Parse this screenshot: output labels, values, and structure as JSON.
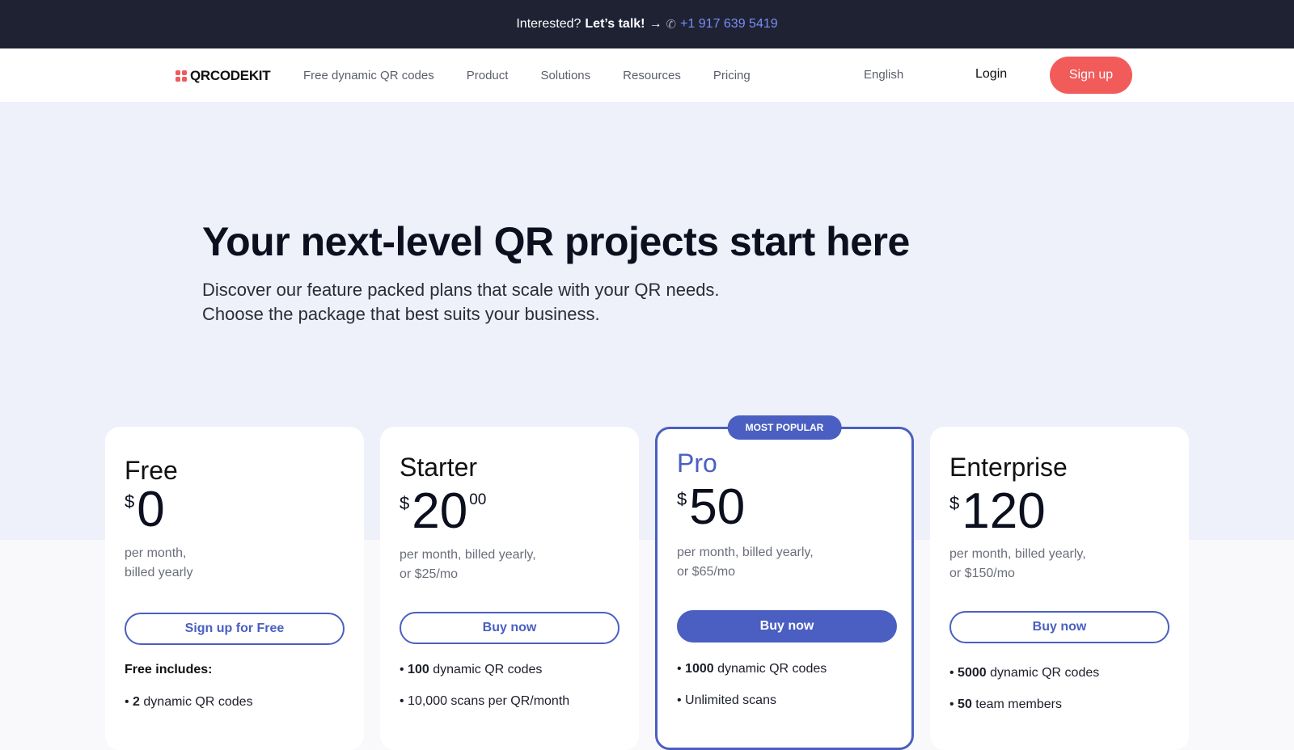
{
  "topbar": {
    "prefix": "Interested?",
    "bold": "Let’s talk!",
    "arrow": "→",
    "phone": "+1 917 639 5419"
  },
  "nav": {
    "logo_text": "QRCODEKIT",
    "links": [
      "Free dynamic QR codes",
      "Product",
      "Solutions",
      "Resources",
      "Pricing"
    ],
    "language": "English",
    "login": "Login",
    "signup": "Sign up"
  },
  "hero": {
    "title": "Your next-level QR projects start here",
    "subtitle_line1": "Discover our feature packed plans that scale with your QR needs.",
    "subtitle_line2": "Choose the package that best suits your business."
  },
  "colors": {
    "accent": "#4a5fc1",
    "brand_red": "#f15b59",
    "topbar": "#1e2233"
  },
  "plans": [
    {
      "name": "Free",
      "currency": "$",
      "amount": "0",
      "cents": "",
      "billing_line1": "per month,",
      "billing_line2": "billed yearly",
      "button": "Sign up for Free",
      "includes_label": "Free includes:",
      "features": [
        {
          "bold": "2",
          "text": " dynamic QR codes"
        }
      ]
    },
    {
      "name": "Starter",
      "currency": "$",
      "amount": "20",
      "cents": "00",
      "billing_line1": "per month, billed yearly,",
      "billing_line2": "or $25/mo",
      "button": "Buy now",
      "features": [
        {
          "bold": "100",
          "text": " dynamic QR codes"
        },
        {
          "bold": "",
          "text": "10,000 scans per QR/month"
        }
      ]
    },
    {
      "name": "Pro",
      "currency": "$",
      "amount": "50",
      "cents": "",
      "badge": "MOST POPULAR",
      "billing_line1": "per month, billed yearly,",
      "billing_line2": "or $65/mo",
      "button": "Buy now",
      "features": [
        {
          "bold": "1000",
          "text": " dynamic QR codes"
        },
        {
          "bold": "",
          "text": "Unlimited scans"
        }
      ]
    },
    {
      "name": "Enterprise",
      "currency": "$",
      "amount": "120",
      "cents": "",
      "billing_line1": "per month, billed yearly,",
      "billing_line2": "or $150/mo",
      "button": "Buy now",
      "features": [
        {
          "bold": "5000",
          "text": " dynamic QR codes"
        },
        {
          "bold": "50",
          "text": " team members"
        }
      ]
    }
  ]
}
